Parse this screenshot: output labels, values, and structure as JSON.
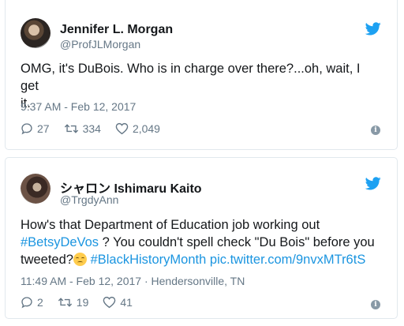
{
  "tweets": [
    {
      "name": "Jennifer L. Morgan",
      "handle": "@ProfJLMorgan",
      "text_line1": "OMG, it's DuBois. Who is in charge over there?...oh, wait, I get",
      "text_line2": "it.",
      "meta": "9:37 AM - Feb 12, 2017",
      "replies": "27",
      "retweets": "334",
      "likes": "2,049"
    },
    {
      "name": "シャロン Ishimaru Kaito",
      "handle": "@TrgdyAnn",
      "text_line1": "How's that Department of Education job working out",
      "hashtag1": "#BetsyDeVos",
      "text_line2_rest": " ? You couldn't spell check \"Du Bois\" before you",
      "text_line3_start": "tweeted?",
      "hashtag2": "#BlackHistoryMonth",
      "link": "pic.twitter.com/9nvxMTr6tS",
      "meta": "11:49 AM - Feb 12, 2017 · Hendersonville, TN",
      "replies": "2",
      "retweets": "19",
      "likes": "41"
    }
  ],
  "icons": {
    "brand": "twitter-bird-icon",
    "reply": "reply-icon",
    "retweet": "retweet-icon",
    "like": "heart-icon",
    "info": "info-icon"
  },
  "colors": {
    "brand_blue": "#1da1f2",
    "link_blue": "#1b95e0",
    "muted": "#657786"
  }
}
